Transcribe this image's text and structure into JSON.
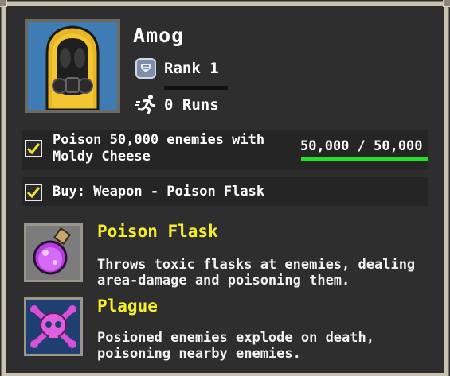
{
  "character": {
    "name": "Amog",
    "rank": "Rank 1",
    "runs": "0 Runs"
  },
  "tasks": [
    {
      "label": "Poison 50,000 enemies with Moldy Cheese",
      "checked": true,
      "progress_text": "50,000 / 50,000",
      "progress_fraction": 1.0
    },
    {
      "label": "Buy: Weapon - Poison Flask",
      "checked": true
    }
  ],
  "rewards": [
    {
      "title": "Poison Flask",
      "description": "Throws toxic flasks at enemies, dealing area-damage and poisoning them.",
      "icon": "poison-flask-icon"
    },
    {
      "title": "Plague",
      "description": "Posioned enemies explode on death, poisoning nearby enemies.",
      "icon": "skull-crossbones-icon"
    }
  ],
  "colors": {
    "title_yellow": "#f5ee2a",
    "progress_green": "#22e022",
    "check_yellow": "#f0e62c"
  }
}
